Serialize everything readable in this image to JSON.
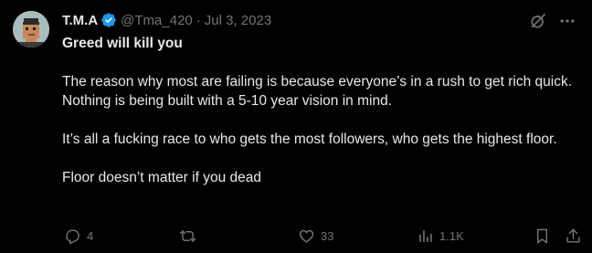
{
  "author": {
    "name": "T.M.A",
    "handle": "@Tma_420",
    "separator": "·",
    "date": "Jul 3, 2023"
  },
  "tweet": {
    "title": "Greed will kill you",
    "paragraph1": "The reason why most are failing is because everyone’s in a rush to get rich quick. Nothing is being built with a 5-10 year vision in mind.",
    "paragraph2": "It’s all a fucking race to who gets the most followers, who gets the highest floor.",
    "paragraph3": "Floor doesn’t matter if you dead"
  },
  "actions": {
    "replies": "4",
    "retweets": "",
    "likes": "33",
    "views": "1.1K"
  },
  "icons": {
    "verified": "verified-badge-icon",
    "grok": "grok-icon",
    "more": "more-icon",
    "reply": "reply-icon",
    "retweet": "retweet-icon",
    "like": "heart-icon",
    "views": "views-icon",
    "bookmark": "bookmark-icon",
    "share": "share-icon"
  },
  "colors": {
    "background": "#000000",
    "text": "#e7e9ea",
    "secondary": "#71767b",
    "verified": "#1d9bf0"
  }
}
